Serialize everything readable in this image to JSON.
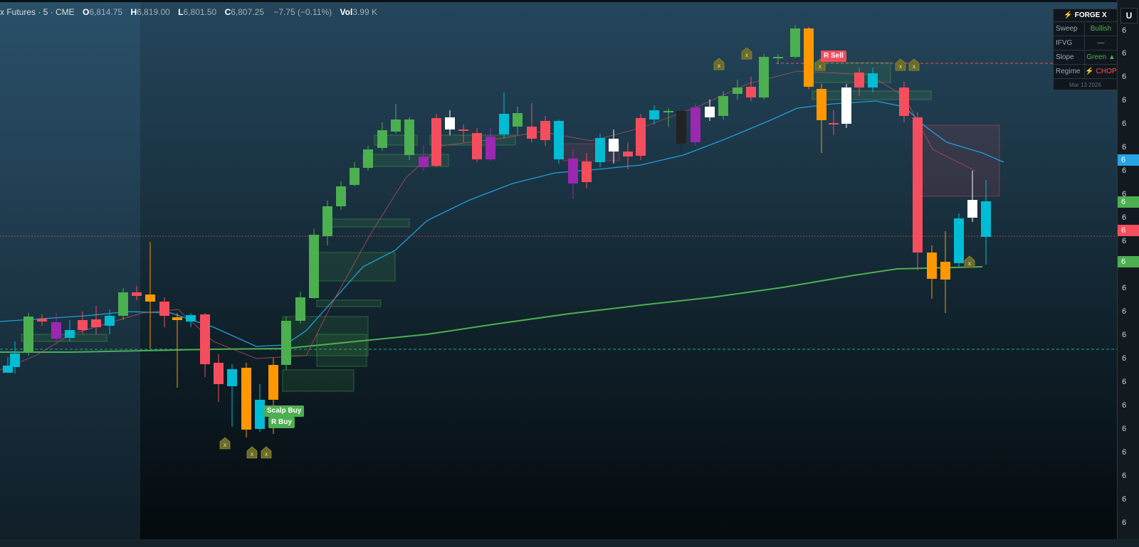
{
  "legend": {
    "symbol": "x Futures · 5 · CME",
    "o_label": "O",
    "o_value": "6,814.75",
    "h_label": "H",
    "h_value": "6,819.00",
    "l_label": "L",
    "l_value": "6,801.50",
    "c_label": "C",
    "c_value": "6,807.25",
    "change": "−7.75 (−0.11%)",
    "vol_label": "Vol",
    "vol_value": "3.99 K"
  },
  "forge_panel": {
    "title": "FORGE X",
    "rows": [
      {
        "label": "Sweep",
        "value": "Bullish",
        "color": "#4caf50"
      },
      {
        "label": "IFVG",
        "value": "—",
        "color": "#9aa6ae"
      },
      {
        "label": "Slope",
        "value": "Green ▲",
        "color": "#4caf50"
      },
      {
        "label": "Regime",
        "value": "CHOP",
        "color": "#ff5252"
      }
    ],
    "date": "Mar 13 2026"
  },
  "signals": {
    "scalp_buy": "Scalp Buy",
    "r_buy": "R Buy",
    "r_sell": "R Sell"
  },
  "price_axis": {
    "top_button": "U",
    "tick_label": "6",
    "badges": [
      {
        "text": "6",
        "color": "#26a5e5"
      },
      {
        "text": "6",
        "color": "#4caf50"
      },
      {
        "text": "6",
        "color": "#f44e5e"
      },
      {
        "text": "6",
        "color": "#4caf50"
      }
    ]
  },
  "marker_glyph": "x",
  "colors": {
    "up": "#4caf50",
    "down": "#f44e5e",
    "orange": "#ff9800",
    "cyan": "#00bcd4",
    "purple": "#9c27b0",
    "white": "#ffffff",
    "ema_fast": "#1fa0d8",
    "ema_slow": "#4caf50",
    "marker": "#6b6b2a"
  },
  "chart_data": {
    "type": "candlestick",
    "candle_colors": [
      "teal",
      "cyan",
      "green",
      "pink",
      "purple",
      "cyan",
      "pink",
      "pink",
      "cyan",
      "green",
      "pink",
      "orange",
      "pink",
      "orange",
      "cyan",
      "pink",
      "pink",
      "cyan",
      "orange",
      "cyan",
      "orange",
      "green",
      "green",
      "green",
      "green",
      "green",
      "green",
      "green",
      "green",
      "green",
      "green",
      "purple",
      "pink",
      "white",
      "pink",
      "pink",
      "purple",
      "cyan",
      "green",
      "pink",
      "pink",
      "cyan",
      "purple",
      "pink",
      "cyan",
      "white",
      "pink",
      "pink",
      "cyan",
      "green",
      "black",
      "purple",
      "white",
      "green",
      "green",
      "pink",
      "green",
      "green",
      "green",
      "orange",
      "orange",
      "pink",
      "white",
      "pink",
      "cyan",
      "pink",
      "pink",
      "orange",
      "orange",
      "cyan",
      "white",
      "cyan",
      "pink"
    ]
  }
}
